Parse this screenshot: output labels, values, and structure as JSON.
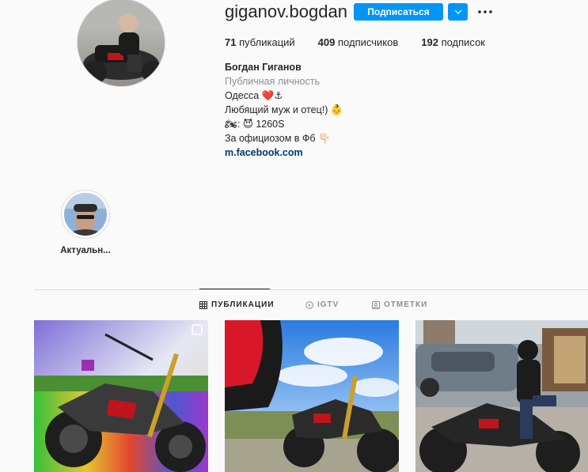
{
  "profile": {
    "username": "giganov.bogdan",
    "follow_label": "Подписаться",
    "stats": {
      "posts_count": "71",
      "posts_label": "публикаций",
      "followers_count": "409",
      "followers_label": "подписчиков",
      "following_count": "192",
      "following_label": "подписок"
    },
    "bio": {
      "name": "Богдан Гиганов",
      "category": "Публичная личность",
      "line1": "Одесса ❤️⚓",
      "line2": "Любящий муж и отец!) 👶",
      "line3": "🏍: 😈 1260S",
      "line4": "За официозом в Фб 👇🏻",
      "link": "m.facebook.com"
    }
  },
  "highlights": [
    {
      "label": "Актуальн..."
    }
  ],
  "tabs": [
    {
      "label": "ПУБЛИКАЦИИ",
      "icon": "grid-icon",
      "active": true
    },
    {
      "label": "IGTV",
      "icon": "igtv-icon",
      "active": false
    },
    {
      "label": "ОТМЕТКИ",
      "icon": "tagged-icon",
      "active": false
    }
  ],
  "colors": {
    "accent": "#0095f6",
    "link": "#00376b",
    "muted": "#8e8e8e",
    "text": "#262626",
    "background": "#fafafa"
  }
}
